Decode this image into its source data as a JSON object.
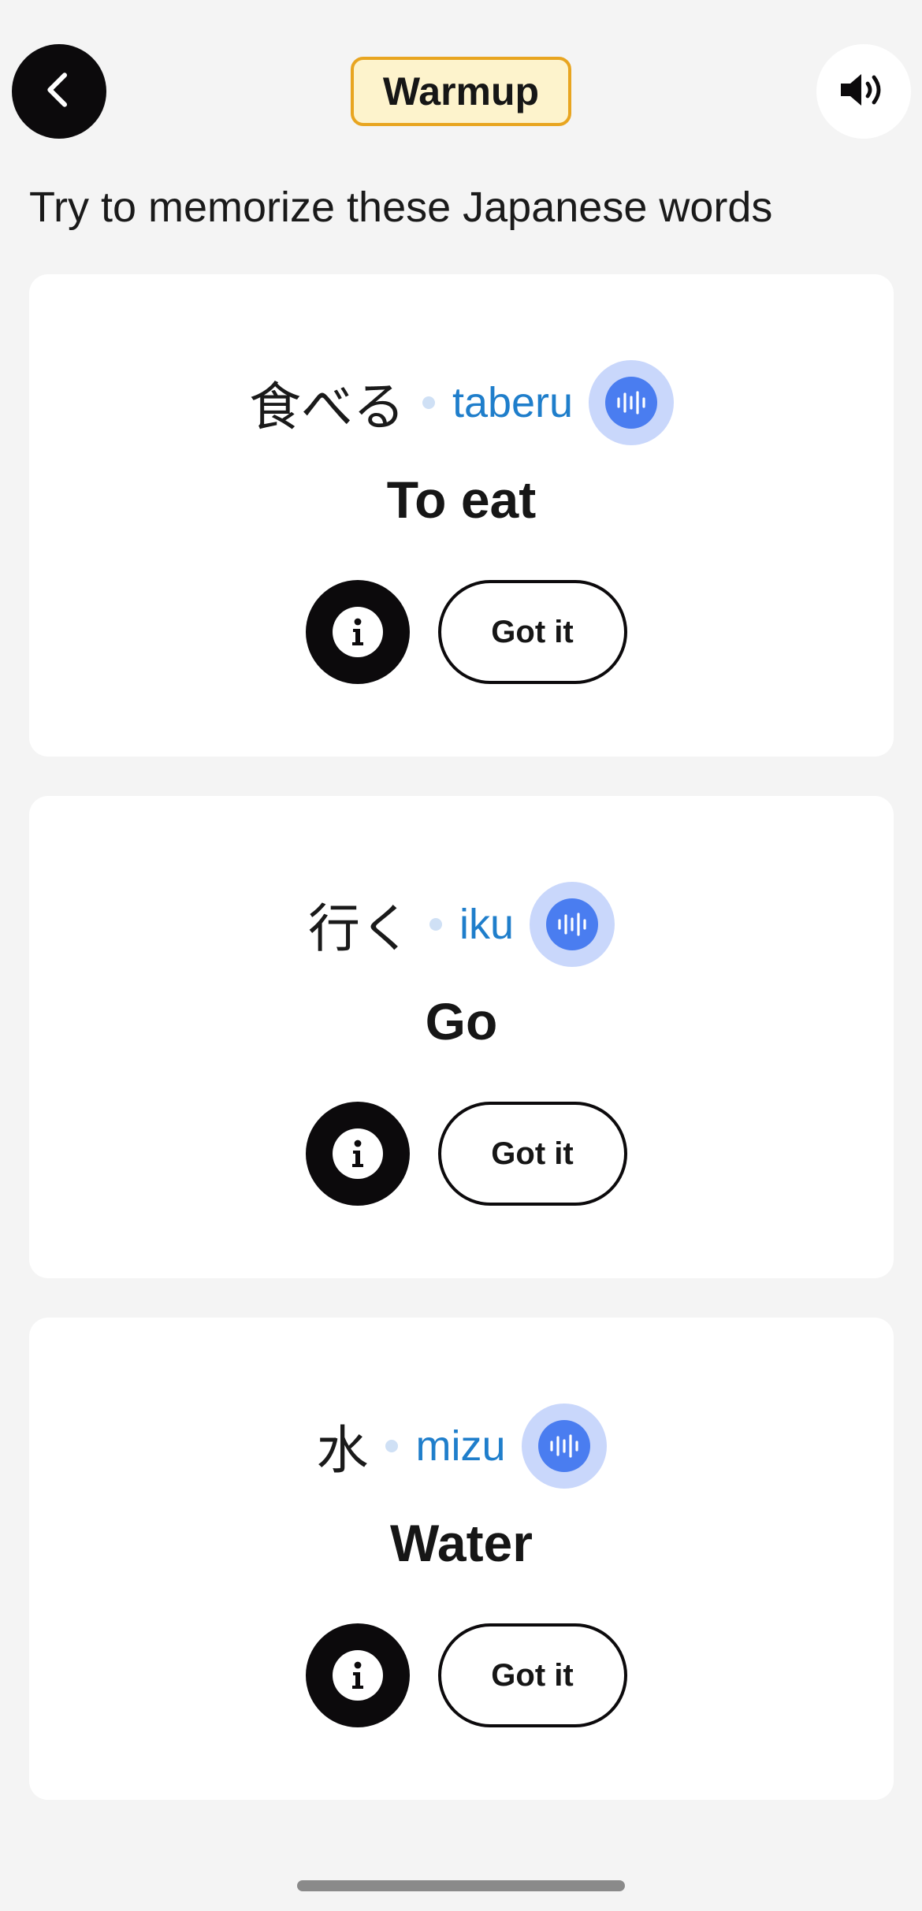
{
  "header": {
    "back_icon": "chevron-left-icon",
    "title": "Warmup",
    "sound_icon": "speaker-icon"
  },
  "instruction": "Try to memorize these Japanese words",
  "cards": [
    {
      "kana": "食べる",
      "romaji": "taberu",
      "meaning": "To eat",
      "info_icon": "info-icon",
      "audio_icon": "waveform-icon",
      "got_it_label": "Got it"
    },
    {
      "kana": "行く",
      "romaji": "iku",
      "meaning": "Go",
      "info_icon": "info-icon",
      "audio_icon": "waveform-icon",
      "got_it_label": "Got it"
    },
    {
      "kana": "水",
      "romaji": "mizu",
      "meaning": "Water",
      "info_icon": "info-icon",
      "audio_icon": "waveform-icon",
      "got_it_label": "Got it"
    }
  ],
  "colors": {
    "background": "#f4f4f4",
    "badge_bg": "#fdf3cc",
    "badge_border": "#e8a520",
    "romaji": "#1f7ecb",
    "audio_outer": "#c9d7fb",
    "audio_inner": "#4a7df0",
    "dark": "#0c0a0c"
  }
}
